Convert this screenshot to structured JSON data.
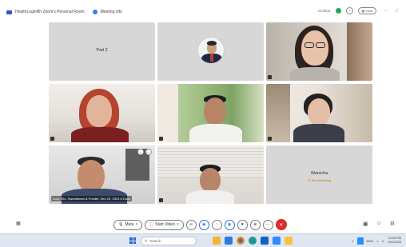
{
  "titlebar": {
    "meeting_title": "HealthLoginRh Zoom's Personal Room",
    "meeting_info_label": "Meeting info",
    "right_label": "ID:0511",
    "view_label": "View",
    "controls": [
      "–",
      "□"
    ]
  },
  "tiles": [
    {
      "kind": "name",
      "name": "Pad 2"
    },
    {
      "kind": "avatar"
    },
    {
      "kind": "video"
    },
    {
      "kind": "video"
    },
    {
      "kind": "video"
    },
    {
      "kind": "video"
    },
    {
      "kind": "video",
      "caption": "Lucy Zhu, Swordsman & Ponder, Dec 19, 2024 8 Duck"
    },
    {
      "kind": "video"
    },
    {
      "kind": "name",
      "name": "Wanicha",
      "sub": "↻ Reconnecting"
    }
  ],
  "controls": {
    "mute_label": "Mute",
    "start_video_label": "Start Video"
  },
  "taskbar": {
    "search_placeholder": "Search",
    "tray_lang": "ENG",
    "time": "12:00 PM",
    "date": "9/11/2024"
  },
  "colors": {
    "end_red": "#e02b2b",
    "zoom_blue": "#2d8cff",
    "tile_gray": "#d7d7d7",
    "taskbar": "#dfe6f1"
  }
}
